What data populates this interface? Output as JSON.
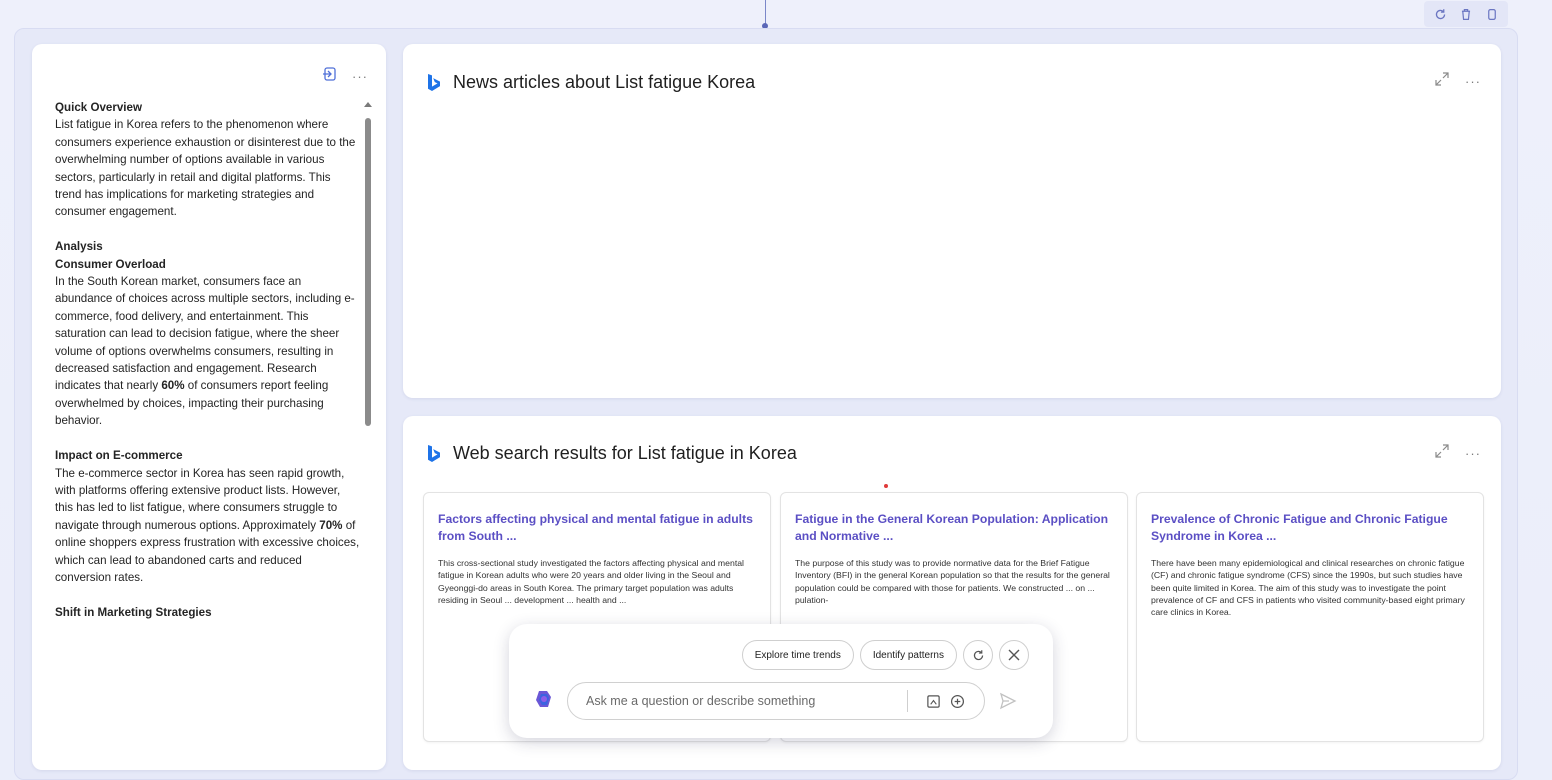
{
  "left_panel": {
    "sections": [
      {
        "heading": "Quick Overview",
        "subheading": "",
        "body": "List fatigue in Korea refers to the phenomenon where consumers experience exhaustion or disinterest due to the overwhelming number of options available in various sectors, particularly in retail and digital platforms. This trend has implications for marketing strategies and consumer engagement."
      },
      {
        "heading": "Analysis",
        "subheading": "Consumer Overload",
        "body_before": "In the South Korean market, consumers face an abundance of choices across multiple sectors, including e-commerce, food delivery, and entertainment. This saturation can lead to decision fatigue, where the sheer volume of options overwhelms consumers, resulting in decreased satisfaction and engagement. Research indicates that nearly ",
        "highlight": "60%",
        "body_after": " of consumers report feeling overwhelmed by choices, impacting their purchasing behavior."
      },
      {
        "heading": "Impact on E-commerce",
        "body_before": "The e-commerce sector in Korea has seen rapid growth, with platforms offering extensive product lists. However, this has led to list fatigue, where consumers struggle to navigate through numerous options. Approximately ",
        "highlight": "70%",
        "body_after": " of online shoppers express frustration with excessive choices, which can lead to abandoned carts and reduced conversion rates."
      },
      {
        "heading": "Shift in Marketing Strategies"
      }
    ],
    "more_label": "···"
  },
  "news_panel": {
    "title": "News articles about List fatigue Korea",
    "more_label": "···"
  },
  "web_panel": {
    "title": "Web search results for List fatigue in Korea",
    "more_label": "···",
    "results": [
      {
        "title": "Factors affecting physical and mental fatigue in adults from South ...",
        "snippet": "This cross-sectional study investigated the factors affecting physical and mental fatigue in Korean adults who were 20 years and older living in the Seoul and Gyeonggi-do areas in South Korea. The primary target population was adults residing in Seoul ... development ... health and ..."
      },
      {
        "title": "Fatigue in the General Korean Population: Application and Normative ...",
        "snippet": "The purpose of this study was to provide normative data for the Brief Fatigue Inventory (BFI) in the general Korean population so that the results for the general population could be compared with those for patients. We constructed ... on ... pulation-"
      },
      {
        "title": "Prevalence of Chronic Fatigue and Chronic Fatigue Syndrome in Korea ...",
        "snippet": "There have been many epidemiological and clinical researches on chronic fatigue (CF) and chronic fatigue syndrome (CFS) since the 1990s, but such studies have been quite limited in Korea. The aim of this study was to investigate the point prevalence of CF and CFS in patients who visited community-based eight primary care clinics in Korea."
      }
    ]
  },
  "chat": {
    "chips": [
      "Explore time trends",
      "Identify patterns"
    ],
    "placeholder": "Ask me a question or describe something"
  },
  "colors": {
    "accent": "#5b4fc4",
    "bing_blue": "#1e73e8",
    "frame_bg": "#e6e9f8"
  }
}
